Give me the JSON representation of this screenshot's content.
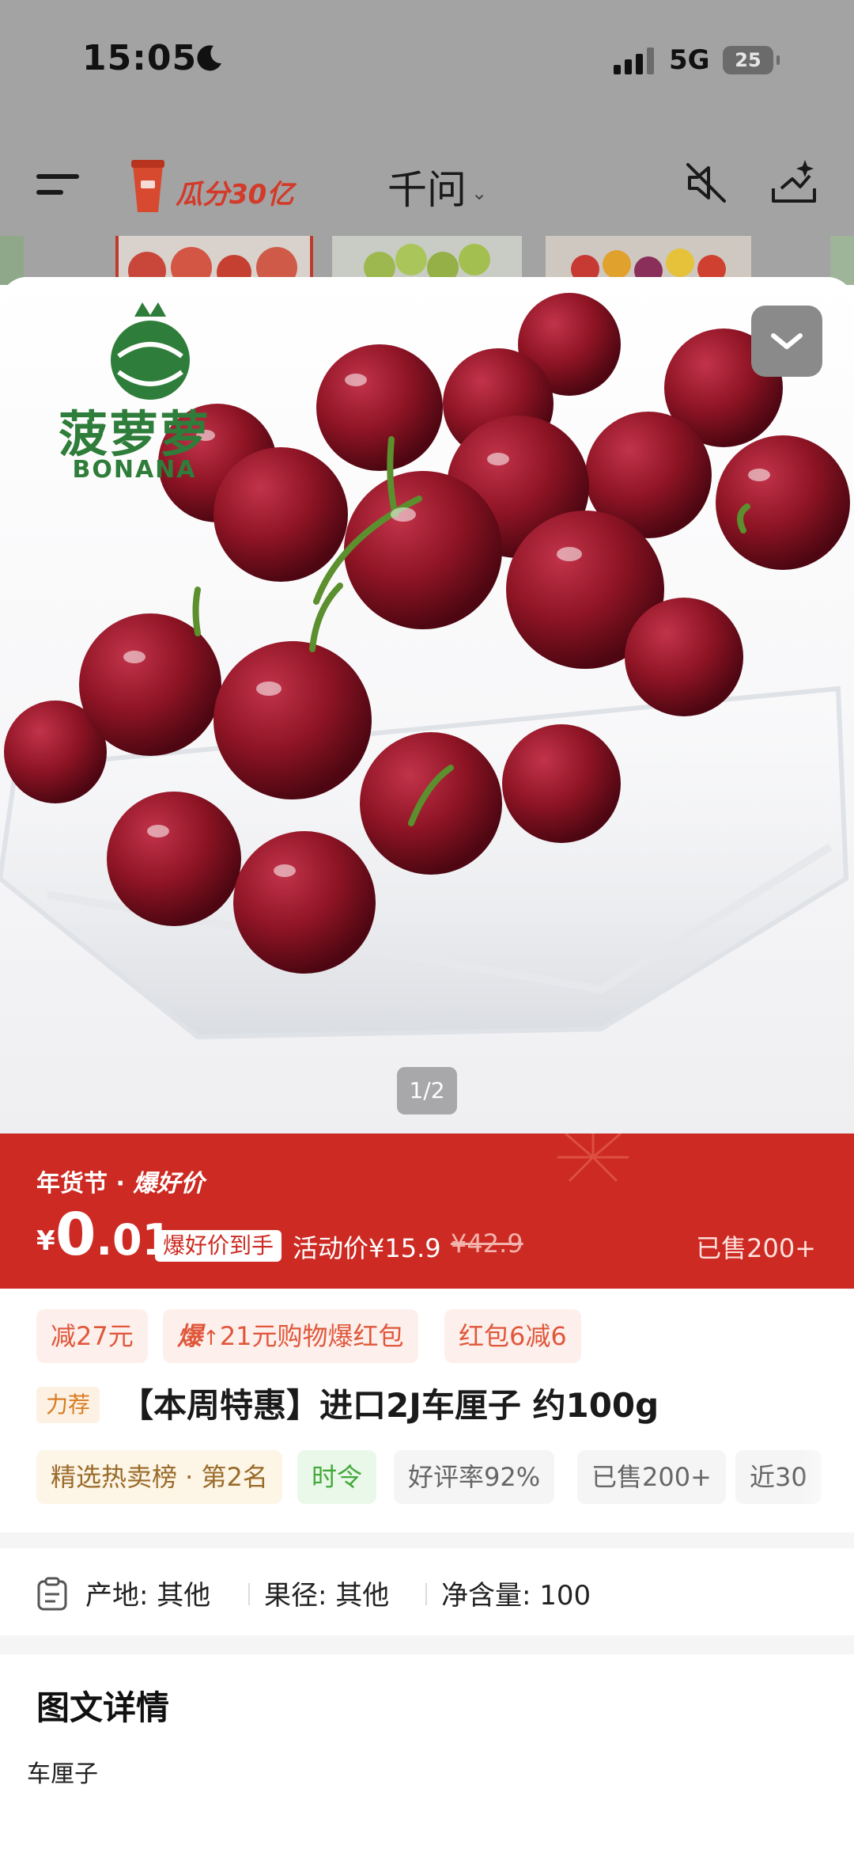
{
  "status_bar": {
    "time": "15:05",
    "network": "5G",
    "battery": "25"
  },
  "nav": {
    "promo_text": "瓜分30亿",
    "title": "千问",
    "title_chevron": "⌄"
  },
  "icons": [
    "menu-icon",
    "moon-icon",
    "signal-icon",
    "mute-icon",
    "share-sparkle-icon",
    "chevron-down-icon",
    "clipboard-icon"
  ],
  "hero": {
    "brand_cn": "菠萝萝",
    "brand_en": "BONANA",
    "pager": "1/2"
  },
  "price_banner": {
    "festival": "年货节 · ",
    "festival_emph": "爆好价",
    "currency": "¥",
    "price_int": "0",
    "price_dec": ".01",
    "hot_tag": "爆好价到手",
    "activity_price": "活动价¥15.9",
    "original_price": "¥42.9",
    "sold": "已售200+"
  },
  "coupons": [
    {
      "text": "减27元"
    },
    {
      "prefix": "爆",
      "text": "21元购物爆红包"
    },
    {
      "text": "红包6减6"
    }
  ],
  "product": {
    "rec_tag": "力荐",
    "title": "【本周特惠】进口2J车厘子 约100g"
  },
  "chips": [
    "精选热卖榜 · 第2名",
    "时令",
    "好评率92%",
    "已售200+",
    "近30"
  ],
  "attributes": [
    "产地:  其他",
    "果径:  其他",
    "净含量:  100"
  ],
  "details": {
    "title": "图文详情",
    "text": "车厘子"
  },
  "colors": {
    "banner_red": "#cc2a22",
    "cherry": "#8e1424",
    "brand_green": "#2f7d3a"
  }
}
